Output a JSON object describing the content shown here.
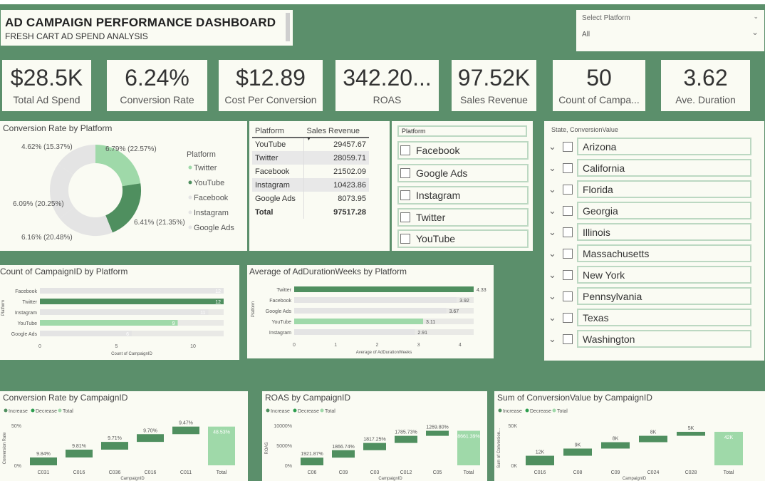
{
  "header": {
    "title": "AD CAMPAIGN PERFORMANCE DASHBOARD",
    "subtitle": "FRESH CART AD SPEND ANALYSIS"
  },
  "platform_slicer": {
    "label": "Select Platform",
    "value": "All"
  },
  "kpis": [
    {
      "value": "$28.5K",
      "label": "Total Ad Spend"
    },
    {
      "value": "6.24%",
      "label": "Conversion Rate"
    },
    {
      "value": "$12.89",
      "label": "Cost Per Conversion"
    },
    {
      "value": "342.20...",
      "label": "ROAS"
    },
    {
      "value": "97.52K",
      "label": "Sales Revenue"
    },
    {
      "value": "50",
      "label": "Count of Campa..."
    },
    {
      "value": "3.62",
      "label": "Ave. Duration"
    }
  ],
  "donut": {
    "title": "Conversion Rate by Platform",
    "legend_title": "Platform",
    "labels": [
      "6.79% (22.57%)",
      "6.41% (21.35%)",
      "6.16% (20.48%)",
      "6.09% (20.25%)",
      "4.62% (15.37%)"
    ]
  },
  "revenue_table": {
    "headers": [
      "Platform",
      "Sales Revenue"
    ],
    "rows": [
      [
        "YouTube",
        "29457.67"
      ],
      [
        "Twitter",
        "28059.71"
      ],
      [
        "Facebook",
        "21502.09"
      ],
      [
        "Instagram",
        "10423.86"
      ],
      [
        "Google Ads",
        "8073.95"
      ]
    ],
    "total": [
      "Total",
      "97517.28"
    ]
  },
  "platform_checklist": {
    "header": "Platform",
    "items": [
      "Facebook",
      "Google Ads",
      "Instagram",
      "Twitter",
      "YouTube"
    ]
  },
  "state_slicer": {
    "header": "State, ConversionValue",
    "items": [
      "Arizona",
      "California",
      "Florida",
      "Georgia",
      "Illinois",
      "Massachusetts",
      "New York",
      "Pennsylvania",
      "Texas",
      "Washington"
    ]
  },
  "colors": {
    "background": "#5b8f6b",
    "dark_green": "#4f8f5f",
    "light_green": "#9fd9a9",
    "grey": "#e4e4e4",
    "panel": "#fafbf3"
  },
  "chart_data": [
    {
      "type": "pie",
      "title": "Conversion Rate by Platform",
      "categories": [
        "Twitter",
        "YouTube",
        "Facebook",
        "Instagram",
        "Google Ads"
      ],
      "values": [
        6.79,
        6.41,
        6.16,
        6.09,
        4.62
      ],
      "shares": [
        22.57,
        21.35,
        20.48,
        20.25,
        15.37
      ],
      "legend": "right"
    },
    {
      "type": "bar",
      "title": "Count of CampaignID by Platform",
      "categories": [
        "Facebook",
        "Twitter",
        "Instagram",
        "YouTube",
        "Google Ads"
      ],
      "values": [
        12,
        12,
        11,
        9,
        6
      ],
      "xlabel": "Count of CampaignID",
      "ylabel": "Platform",
      "xticks": [
        "0",
        "5",
        "10"
      ],
      "xlim": [
        0,
        12
      ]
    },
    {
      "type": "bar",
      "title": "Average of AdDurationWeeks by Platform",
      "categories": [
        "Twitter",
        "Facebook",
        "Google Ads",
        "YouTube",
        "Instagram"
      ],
      "values": [
        4.33,
        3.92,
        3.67,
        3.11,
        2.91
      ],
      "xlabel": "Average of AdDurationWeeks",
      "ylabel": "Platform",
      "xticks": [
        "0",
        "1",
        "2",
        "3",
        "4"
      ],
      "xlim": [
        0,
        4.33
      ]
    },
    {
      "type": "bar",
      "title": "Conversion Rate by CampaignID",
      "legend": [
        "Increase",
        "Decrease",
        "Total"
      ],
      "categories": [
        "C031",
        "C016",
        "C036",
        "C016",
        "C011",
        "Total"
      ],
      "values": [
        9.84,
        9.81,
        9.71,
        9.7,
        9.47,
        48.53
      ],
      "data_labels": [
        "9.84%",
        "9.81%",
        "9.71%",
        "9.70%",
        "9.47%",
        "48.53%"
      ],
      "yticks": [
        "0%",
        "50%"
      ],
      "ylabel": "Conversion Rate",
      "xlabel": "CampaignID",
      "ylim": [
        0,
        50
      ]
    },
    {
      "type": "bar",
      "title": "ROAS by CampaignID",
      "legend": [
        "Increase",
        "Decrease",
        "Total"
      ],
      "categories": [
        "C06",
        "C09",
        "C03",
        "C012",
        "C05",
        "Total"
      ],
      "values": [
        1921.87,
        1866.74,
        1817.25,
        1785.73,
        1269.8,
        8661.39
      ],
      "data_labels": [
        "1921.87%",
        "1866.74%",
        "1817.25%",
        "1785.73%",
        "1269.80%",
        "8661.39%"
      ],
      "yticks": [
        "0%",
        "5000%",
        "10000%"
      ],
      "ylabel": "ROAS",
      "xlabel": "CampaignID",
      "ylim": [
        0,
        10000
      ]
    },
    {
      "type": "bar",
      "title": "Sum of ConversionValue by CampaignID",
      "legend": [
        "Increase",
        "Decrease",
        "Total"
      ],
      "categories": [
        "C016",
        "C08",
        "C09",
        "C024",
        "C028",
        "Total"
      ],
      "values": [
        12,
        9,
        8,
        8,
        5,
        42
      ],
      "data_labels": [
        "12K",
        "9K",
        "8K",
        "8K",
        "5K",
        "42K"
      ],
      "yticks": [
        "0K",
        "50K"
      ],
      "ylabel": "Sum of Conversion...",
      "xlabel": "CampaignID",
      "ylim": [
        0,
        50
      ]
    }
  ]
}
